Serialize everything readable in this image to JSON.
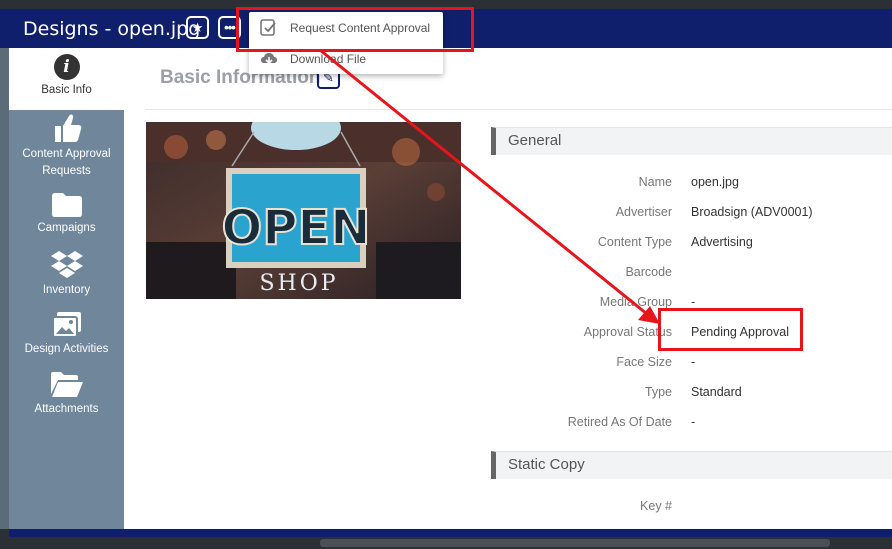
{
  "header": {
    "title": "Designs - open.jpg",
    "star_icon": "star-icon",
    "more_icon": "more-icon",
    "bg_color": "#0f1f6b"
  },
  "menu": {
    "items": [
      {
        "label": "Request Content Approval",
        "icon": "approval-check-icon"
      },
      {
        "label": "Download File",
        "icon": "cloud-download-icon"
      }
    ]
  },
  "sidebar": {
    "items": [
      {
        "label": "Basic Info",
        "icon": "info-icon",
        "active": true
      },
      {
        "label": "Content Approval Requests",
        "icon": "thumbs-up-icon"
      },
      {
        "label": "Campaigns",
        "icon": "folder-icon"
      },
      {
        "label": "Inventory",
        "icon": "dropbox-icon"
      },
      {
        "label": "Design Activities",
        "icon": "images-icon"
      },
      {
        "label": "Attachments",
        "icon": "folder-open-icon"
      }
    ]
  },
  "main": {
    "section_title": "Basic Information",
    "photo": {
      "sign_text": "OPEN",
      "sign_subtext": "SHOP"
    },
    "general": {
      "title": "General",
      "rows": [
        {
          "label": "Name",
          "value": "open.jpg"
        },
        {
          "label": "Advertiser",
          "value": "Broadsign (ADV0001)"
        },
        {
          "label": "Content Type",
          "value": "Advertising"
        },
        {
          "label": "Barcode",
          "value": ""
        },
        {
          "label": "Media Group",
          "value": "-"
        },
        {
          "label": "Approval Status",
          "value": "Pending Approval"
        },
        {
          "label": "Face Size",
          "value": "-"
        },
        {
          "label": "Type",
          "value": "Standard"
        },
        {
          "label": "Retired As Of Date",
          "value": "-"
        }
      ]
    },
    "static_copy": {
      "title": "Static Copy",
      "rows": [
        {
          "label": "Key #",
          "value": ""
        }
      ]
    }
  },
  "annotation_color": "#e8141c"
}
